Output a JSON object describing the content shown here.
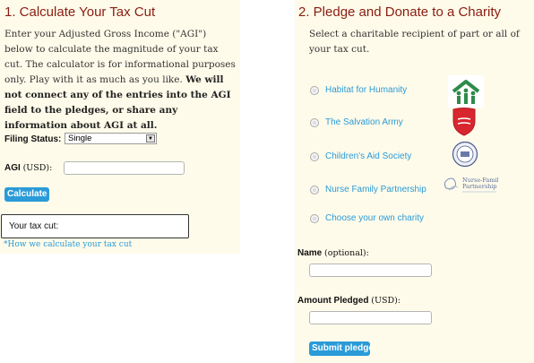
{
  "calculator": {
    "title": "1. Calculate Your Tax Cut",
    "intro_plain": "Enter your Adjusted Gross Income (\"AGI\") below to calculate the magnitude of your tax cut. The calculator is for informational purposes only. Play with it as much as you like.",
    "intro_bold": "We will not connect any of the entries into the AGI field to the pledges, or share any information about AGI at all.",
    "filing_status_label": "Filing Status:",
    "filing_status_value": "Single",
    "agi_label": "AGI",
    "agi_unit": "(USD):",
    "agi_value": "",
    "calculate_button": "Calculate",
    "result_label": "Your tax cut:",
    "how_link": "*How we calculate your tax cut"
  },
  "pledge": {
    "title": "2. Pledge and Donate to a Charity",
    "intro": "Select a charitable recipient of part or all of your tax cut.",
    "charities": [
      {
        "label": "Habitat for Humanity",
        "icon": "habitat-logo"
      },
      {
        "label": "The Salvation Army",
        "icon": "salvation-army-shield"
      },
      {
        "label": "Children's Aid Society",
        "icon": "childrens-aid-seal"
      },
      {
        "label": "Nurse Family Partnership",
        "icon": "nurse-family-partnership-logo",
        "logo_text": [
          "Nurse-Family",
          "Partnership"
        ]
      },
      {
        "label": "Choose your own charity"
      }
    ],
    "name_label": "Name",
    "name_optional": "(optional):",
    "name_value": "",
    "amount_label": "Amount Pledged",
    "amount_unit": "(USD):",
    "amount_value": "",
    "submit_button": "Submit pledge"
  },
  "colors": {
    "heading": "#8a1c12",
    "link": "#2a9bd8",
    "button": "#2a9bd8",
    "panel_bg": "#fffbea"
  }
}
